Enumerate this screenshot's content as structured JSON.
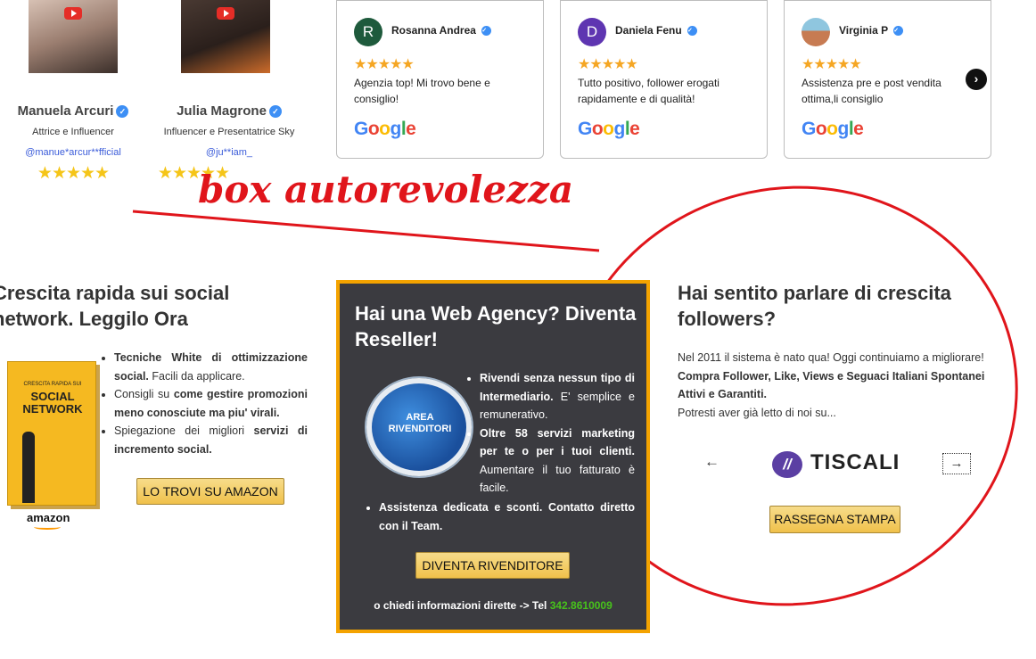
{
  "influencers": [
    {
      "name": "Manuela Arcuri",
      "role": "Attrice e Influencer",
      "handle": "@manue*arcur**fficial",
      "stars": "★★★★★"
    },
    {
      "name": "Julia Magrone",
      "role": "Influencer e Presentatrice Sky",
      "handle": "@ju**iam_",
      "stars": "★★★★★"
    }
  ],
  "reviews": [
    {
      "initial": "R",
      "name": "Rosanna Andrea",
      "stars": "★★★★★",
      "text": "Agenzia top! Mi trovo bene e consiglio!",
      "avatar_color": "#1e5a3c"
    },
    {
      "initial": "D",
      "name": "Daniela Fenu",
      "stars": "★★★★★",
      "text": "Tutto positivo, follower erogati rapidamente e di qualità!",
      "avatar_color": "#5e35b1"
    },
    {
      "initial": "",
      "name": "Virginia P",
      "stars": "★★★★★",
      "text": "Assistenza pre e post vendita ottima,li consiglio",
      "avatar_color": "#c77b52"
    }
  ],
  "google_logo": "Google",
  "annotation": "box autorevolezza",
  "left": {
    "title": "Crescita rapida sui social network. Leggilo Ora",
    "book_title": "SOCIAL NETWORK",
    "book_kicker": "CRESCITA RAPIDA SUI",
    "list": [
      {
        "bold1": "Tecniche White di ottimizzazione social.",
        "text": " Facili da applicare."
      },
      {
        "text": "Consigli su ",
        "bold2": "come gestire promozioni meno conosciute ma piu' virali."
      },
      {
        "text": "Spiegazione dei migliori ",
        "bold2": "servizi di incremento social."
      }
    ],
    "amazon_label": "amazon",
    "button": "LO TROVI SU AMAZON"
  },
  "reseller": {
    "title": "Hai una Web Agency? Diventa Reseller!",
    "badge": "AREA RIVENDITORI",
    "list_a": [
      {
        "bold": "Rivendi senza nessun tipo di Intermediario.",
        "text": " E' semplice e remunerativo."
      },
      {
        "bold": "Oltre 58 servizi marketing per te o per i tuoi clienti.",
        "text": " Aumentare il tuo fatturato è facile."
      }
    ],
    "list_b": [
      "Assistenza dedicata e sconti. Contatto diretto con il Team."
    ],
    "button": "DIVENTA RIVENDITORE",
    "contact_label": "o chiedi informazioni dirette -> Tel",
    "phone": "342.8610009"
  },
  "right": {
    "title": "Hai sentito parlare di crescita followers?",
    "text1": "Nel 2011 il sistema è nato qua! Oggi continuiamo a migliorare! ",
    "text_bold": "Compra Follower, Like, Views e Seguaci Italiani Spontanei Attivi e Garantiti.",
    "text2": "Potresti aver già letto di noi su...",
    "press_logo": "TISCALI",
    "button": "RASSEGNA STAMPA"
  },
  "colors": {
    "accent_red": "#e0151b",
    "reseller_bg": "#3b3b40",
    "reseller_border": "#f4a300",
    "phone_green": "#47c21b"
  }
}
